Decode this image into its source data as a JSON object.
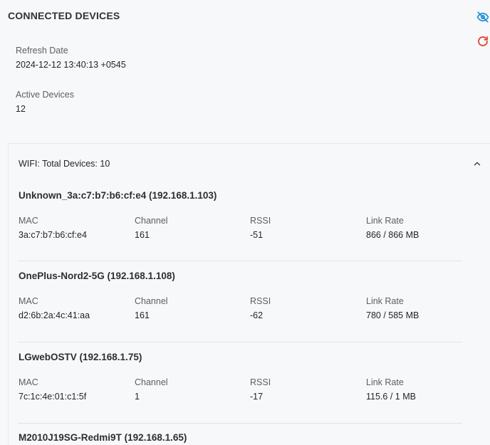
{
  "title": "CONNECTED DEVICES",
  "icons": {
    "hide": "eye-off-icon",
    "refresh": "refresh-icon",
    "collapse": "chevron-up-icon"
  },
  "colors": {
    "hide_icon": "#1e8fd6",
    "refresh_icon": "#e0412c"
  },
  "refresh": {
    "label": "Refresh Date",
    "value": "2024-12-12 13:40:13 +0545"
  },
  "active": {
    "label": "Active Devices",
    "value": "12"
  },
  "wifi": {
    "header": "WIFI: Total Devices: 10",
    "field_labels": {
      "mac": "MAC",
      "channel": "Channel",
      "rssi": "RSSI",
      "link_rate": "Link Rate"
    },
    "devices": [
      {
        "name": "Unknown_3a:c7:b7:b6:cf:e4 (192.168.1.103)",
        "mac": "3a:c7:b7:b6:cf:e4",
        "channel": "161",
        "rssi": "-51",
        "link_rate": "866 / 866 MB"
      },
      {
        "name": "OnePlus-Nord2-5G (192.168.1.108)",
        "mac": "d2:6b:2a:4c:41:aa",
        "channel": "161",
        "rssi": "-62",
        "link_rate": "780 / 585 MB"
      },
      {
        "name": "LGwebOSTV (192.168.1.75)",
        "mac": "7c:1c:4e:01:c1:5f",
        "channel": "1",
        "rssi": "-17",
        "link_rate": "115.6 / 1 MB"
      },
      {
        "name": "M2010J19SG-Redmi9T (192.168.1.65)"
      }
    ]
  }
}
